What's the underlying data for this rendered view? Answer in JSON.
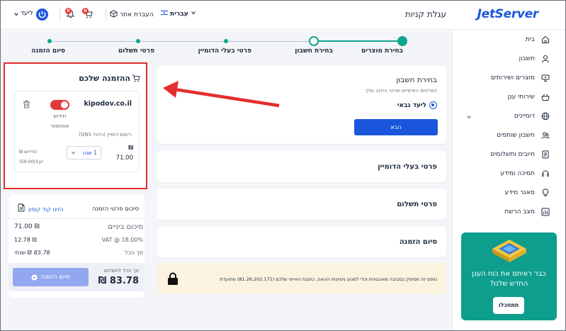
{
  "header": {
    "logo": "JetServer",
    "page_title": "עגלת קניות",
    "language": "עברית",
    "transfer_site": "העברת אתר",
    "cart_count": "0",
    "notif_count": "0",
    "user_name": "ליעד"
  },
  "sidebar": {
    "items": [
      {
        "label": "בית",
        "icon": "home-icon"
      },
      {
        "label": "חשבון",
        "icon": "user-icon"
      },
      {
        "label": "מוצרים ושירותים",
        "icon": "products-icon"
      },
      {
        "label": "שירותי ענן",
        "icon": "cloud-icon"
      },
      {
        "label": "דומיינים",
        "icon": "globe-icon"
      },
      {
        "label": "חשבון שותפים",
        "icon": "partners-icon"
      },
      {
        "label": "חיובים ותשלומים",
        "icon": "billing-icon"
      },
      {
        "label": "תמיכה ומידע",
        "icon": "headset-icon"
      },
      {
        "label": "מאגר מידע",
        "icon": "bulb-icon"
      },
      {
        "label": "מצב הרשת",
        "icon": "network-icon"
      }
    ],
    "promo_text_1": "כבר ראיתם את כוח הענן",
    "promo_text_2": "החדש שלנו?",
    "promo_button": "תתחכלו"
  },
  "steps": [
    {
      "label": "בחירת מוצרים",
      "state": "done"
    },
    {
      "label": "בחירת חשבון",
      "state": "current"
    },
    {
      "label": "פרטי בעלי הדומיין",
      "state": "todo"
    },
    {
      "label": "פרטי תשלום",
      "state": "todo"
    },
    {
      "label": "סיום הזמנה",
      "state": "todo"
    }
  ],
  "account_card": {
    "title": "בחירת חשבון",
    "subtitle": "הפרטים האישיים ופרטי החיוב שלך",
    "option": "ליעד גבאי",
    "next_button": "הבא"
  },
  "collapsed_sections": [
    "פרטי בעלי הדומיין",
    "פרטי תשלום",
    "סיום הזמנה"
  ],
  "order": {
    "title": "ההזמנה שלכם",
    "domain": "kipodov.co.il",
    "renew_label_1": "חידוש",
    "renew_label_2": "אוטומטי",
    "dns_label": "רישום דומיין (ניהול DNS)",
    "currency": "₪",
    "price": "71.00",
    "period": "1 שנה",
    "renew_note": "(חידוש ₪",
    "renew_price": "(59.00/1yr"
  },
  "summary": {
    "title": "סיכום פרטי הזמנה",
    "coupon": "הזינו קוד קופון",
    "subtotal_label": "סיכום ביניים",
    "subtotal_value": "71.00 ₪",
    "vat_label": "VAT @ 18.00%",
    "vat_value": "12.78 ₪",
    "total_label": "סך הכל",
    "total_value": "83.78 ₪ שנתי",
    "pay_label": "סך הכל לתשלום",
    "pay_value": "83.78 ₪",
    "finish_button": "סיום הזמנה"
  },
  "notice": {
    "text": "טופס זה מסופק בסביבה מאובטחת וכדי למנוע ניסיונות הונאה, כתובת האייפי שלכם (81.26.202.171) מתועדת"
  },
  "colors": {
    "brand": "#1a56db",
    "step_done": "#0ea58f",
    "alert": "#e52d2d",
    "promo": "#0e9e8e"
  }
}
